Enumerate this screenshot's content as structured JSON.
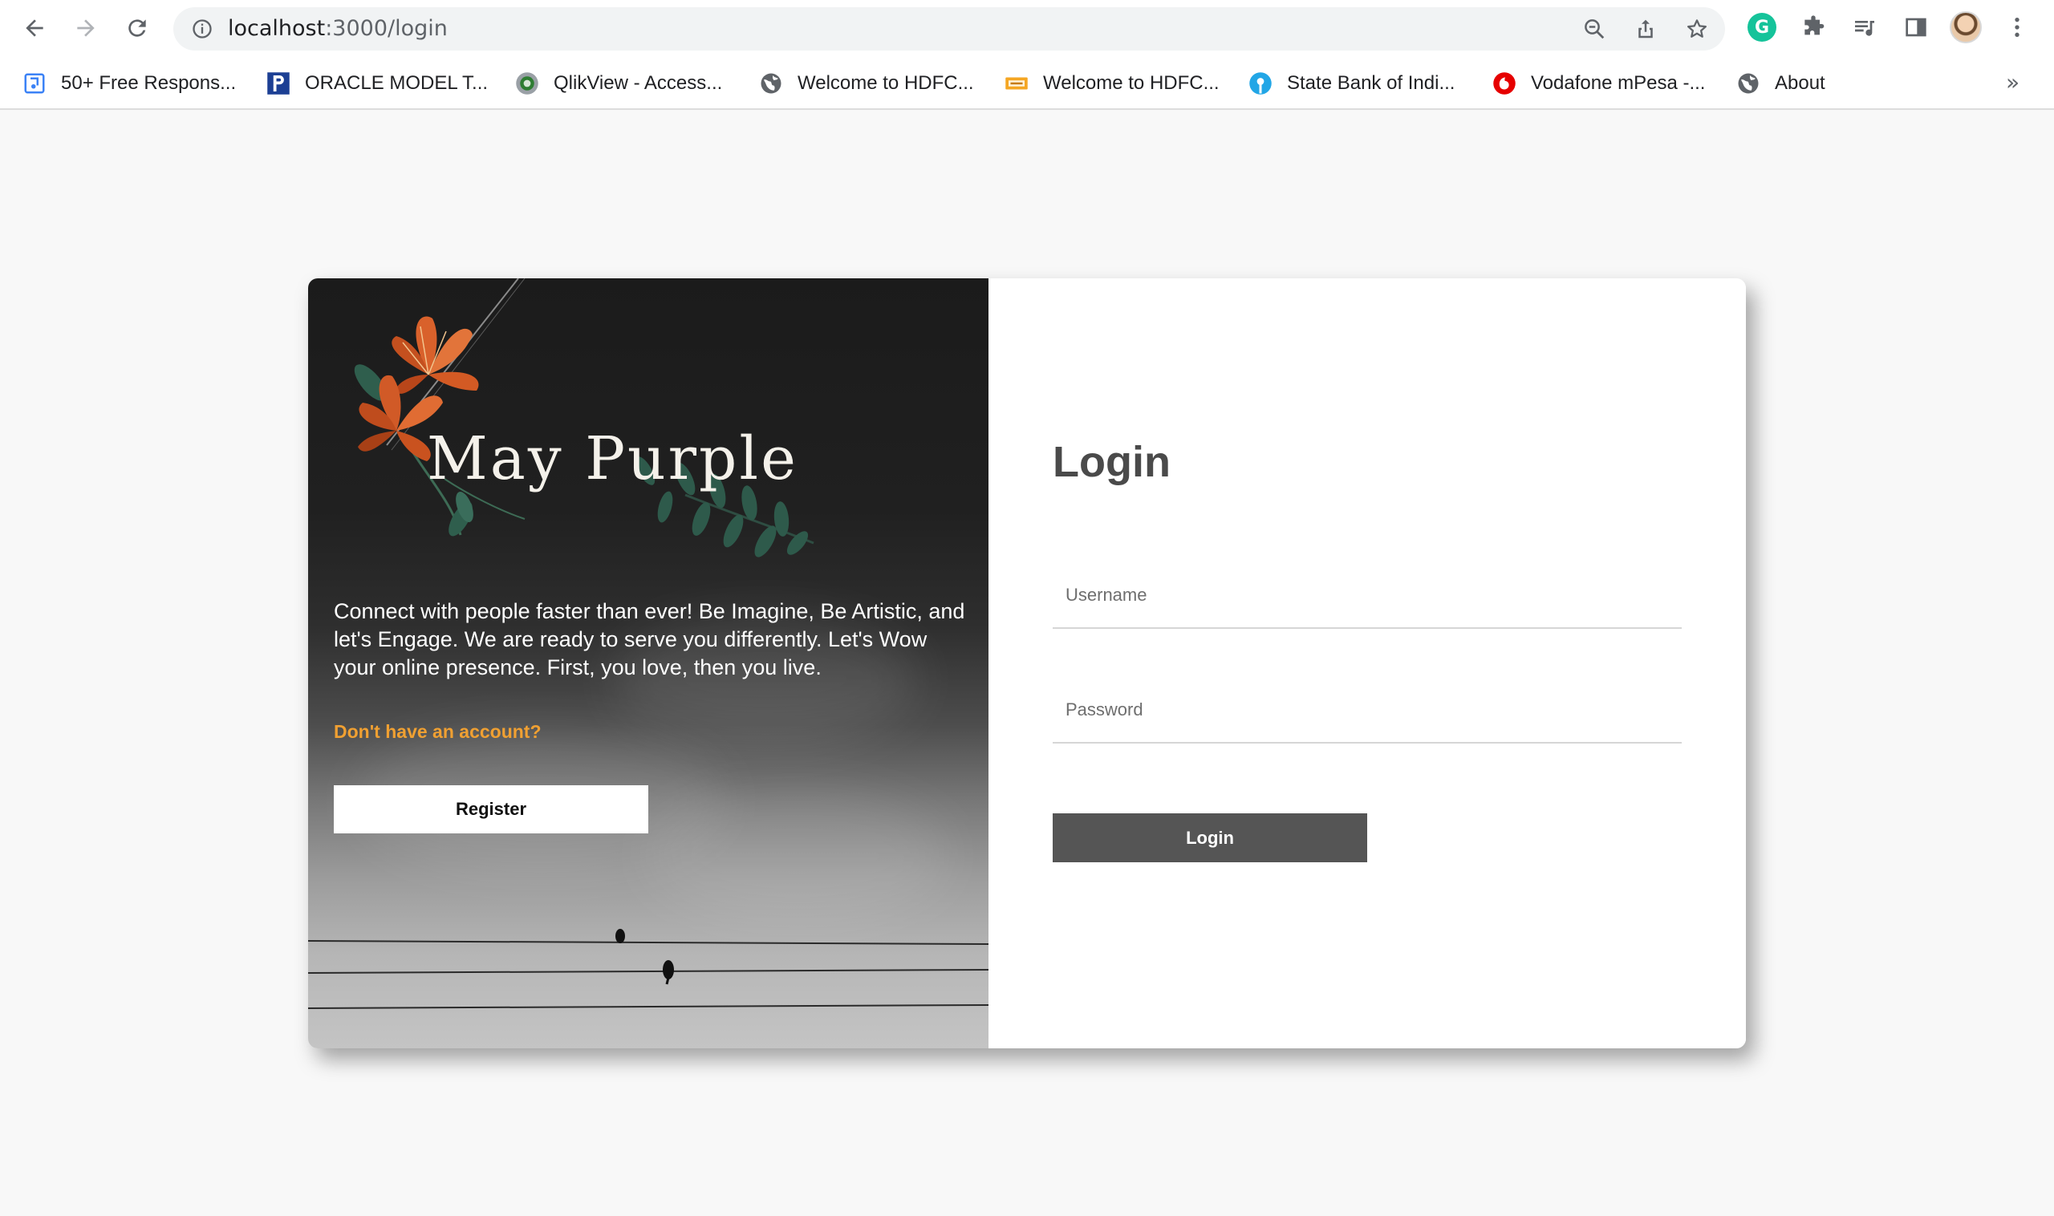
{
  "browser": {
    "url_host": "localhost",
    "url_path": ":3000/login"
  },
  "bookmarks": [
    {
      "label": "50+ Free Respons...",
      "icon": "doc-bookmark-icon"
    },
    {
      "label": "ORACLE MODEL T...",
      "icon": "p-logo-icon"
    },
    {
      "label": "QlikView - Access...",
      "icon": "qlikview-icon"
    },
    {
      "label": "Welcome to HDFC...",
      "icon": "globe-icon"
    },
    {
      "label": "Welcome to HDFC...",
      "icon": "bank-card-icon"
    },
    {
      "label": "State Bank of Indi...",
      "icon": "sbi-icon"
    },
    {
      "label": "Vodafone mPesa -...",
      "icon": "vodafone-icon"
    },
    {
      "label": "About",
      "icon": "globe-icon"
    }
  ],
  "bookmarks_more": "»",
  "extensions": {
    "grammarly_letter": "G"
  },
  "left": {
    "brand": "May Purple",
    "tagline": "Connect with people faster than ever! Be Imagine, Be Artistic, and let's Engage. We are ready to serve you differently. Let's Wow your online presence. First, you love, then you live.",
    "signup_prompt": "Don't have an account?",
    "register_label": "Register"
  },
  "login": {
    "title": "Login",
    "username_placeholder": "Username",
    "password_placeholder": "Password",
    "button_label": "Login"
  },
  "colors": {
    "accent_orange": "#f0a032",
    "login_button": "#555555",
    "heading": "#4a4a4a"
  }
}
